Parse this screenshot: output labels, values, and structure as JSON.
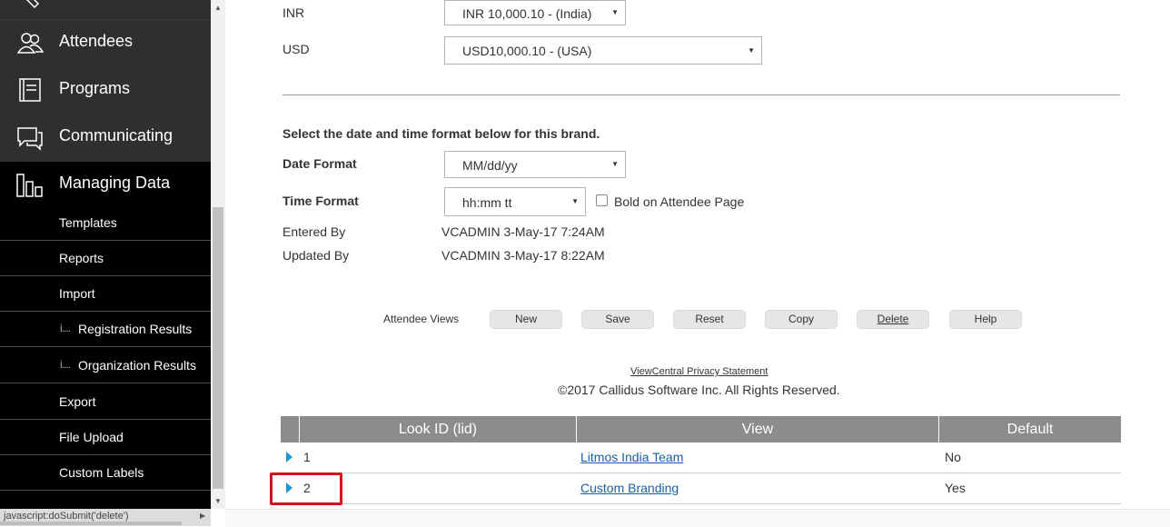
{
  "sidebar": {
    "main_items": [
      {
        "label": "Attendees",
        "icon": "attendees-icon"
      },
      {
        "label": "Programs",
        "icon": "programs-icon"
      },
      {
        "label": "Communicating",
        "icon": "communicating-icon"
      },
      {
        "label": "Managing Data",
        "icon": "managing-data-icon"
      }
    ],
    "sub_items": [
      {
        "label": "Templates"
      },
      {
        "label": "Reports"
      },
      {
        "label": "Import"
      },
      {
        "label": "Registration Results",
        "tree": "i...."
      },
      {
        "label": "Organization Results",
        "tree": "i...."
      },
      {
        "label": "Export"
      },
      {
        "label": "File Upload"
      },
      {
        "label": "Custom Labels"
      }
    ]
  },
  "status_bar": {
    "text": "javascript:doSubmit('delete')"
  },
  "currency": {
    "inr_label": "INR",
    "inr_value": "INR 10,000.10 - (India)",
    "usd_label": "USD",
    "usd_value": "USD10,000.10 - (USA)"
  },
  "datetime": {
    "intro": "Select the date and time format below for this brand.",
    "date_label": "Date Format",
    "date_value": "MM/dd/yy",
    "time_label": "Time Format",
    "time_value": "hh:mm tt",
    "bold_label": "Bold on Attendee Page"
  },
  "audit": {
    "entered_label": "Entered By",
    "entered_value": "VCADMIN 3-May-17 7:24AM",
    "updated_label": "Updated By",
    "updated_value": "VCADMIN 3-May-17 8:22AM"
  },
  "actions": {
    "label": "Attendee Views",
    "buttons": [
      "New",
      "Save",
      "Reset",
      "Copy",
      "Delete",
      "Help"
    ]
  },
  "footer": {
    "privacy": "ViewCentral Privacy Statement",
    "copyright": "©2017 Callidus Software Inc. All Rights Reserved."
  },
  "table": {
    "headers": [
      "Look ID (lid)",
      "View",
      "Default"
    ],
    "rows": [
      {
        "id": "1",
        "view": "Litmos India Team",
        "default": "No"
      },
      {
        "id": "2",
        "view": "Custom Branding",
        "default": "Yes"
      }
    ]
  }
}
